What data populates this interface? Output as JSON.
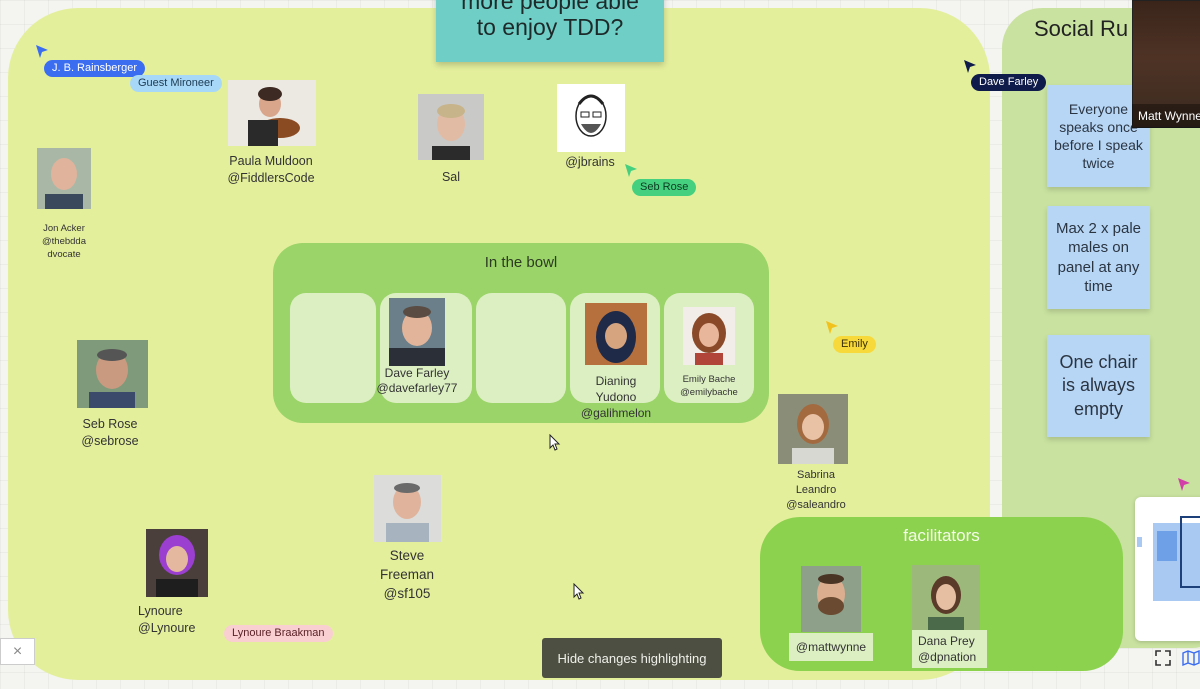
{
  "board": {
    "sticky_top": {
      "line1": "more people able",
      "line2": "to enjoy TDD?"
    },
    "social_title": "Social Ru",
    "social_notes": [
      "Everyone speaks once before I speak twice",
      "Max 2 x pale males on panel at any time",
      "One chair is always empty"
    ],
    "bowl": {
      "title": "In the bowl",
      "members": [
        {
          "name": "Dave Farley",
          "handle": "@davefarley77"
        },
        {
          "name1": "Dianing",
          "name2": "Yudono",
          "handle": "@galihmelon"
        },
        {
          "name": "Emily Bache",
          "handle": "@emilybache"
        }
      ]
    },
    "facilitators": {
      "title": "facilitators",
      "members": [
        {
          "handle": "@mattwynne"
        },
        {
          "name": "Dana Prey",
          "handle": "@dpnation"
        }
      ]
    },
    "people": {
      "paula": {
        "name": "Paula Muldoon",
        "handle": "@FiddlersCode"
      },
      "sal": {
        "name": "Sal"
      },
      "jbrains": {
        "handle": "@jbrains"
      },
      "jon": {
        "line1": "Jon Acker",
        "line2": "@thebdda",
        "line3": "dvocate"
      },
      "seb": {
        "name": "Seb Rose",
        "handle": "@sebrose"
      },
      "sabrina": {
        "line1": "Sabrina",
        "line2": "Leandro",
        "line3": "@saleandro"
      },
      "steve": {
        "line1": "Steve",
        "line2": "Freeman",
        "line3": "@sf105"
      },
      "lynoure": {
        "name": "Lynoure",
        "handle": "@Lynoure"
      }
    }
  },
  "cursors": [
    {
      "label": "J. B. Rainsberger",
      "bg": "#3b6df0",
      "fg": "#ffffff"
    },
    {
      "label": "Guest Mironeer",
      "bg": "#a8d8f7",
      "fg": "#1d3a52"
    },
    {
      "label": "Seb Rose",
      "bg": "#44d07f",
      "fg": "#0d3a20"
    },
    {
      "label": "Dave Farley",
      "bg": "#0f1b4a",
      "fg": "#ffffff"
    },
    {
      "label": "Emily",
      "bg": "#f8d93c",
      "fg": "#3a3000"
    },
    {
      "label": "Lynoure Braakman",
      "bg": "#f9cfd2",
      "fg": "#5a2226"
    }
  ],
  "ui": {
    "hide_changes": "Hide changes highlighting",
    "video_name": "Matt Wynne",
    "close_glyph": "×",
    "icons": [
      "close-icon",
      "fullscreen-icon",
      "map-icon",
      "pointer-cursor-icon"
    ]
  },
  "colors": {
    "main_frame": "#e4ef9c",
    "social_frame": "#c9e2a0",
    "bowl": "#9bd468",
    "facilitators": "#8cd24f",
    "sticky_teal": "#6fcfc6",
    "sticky_blue": "#b7d6f5"
  }
}
